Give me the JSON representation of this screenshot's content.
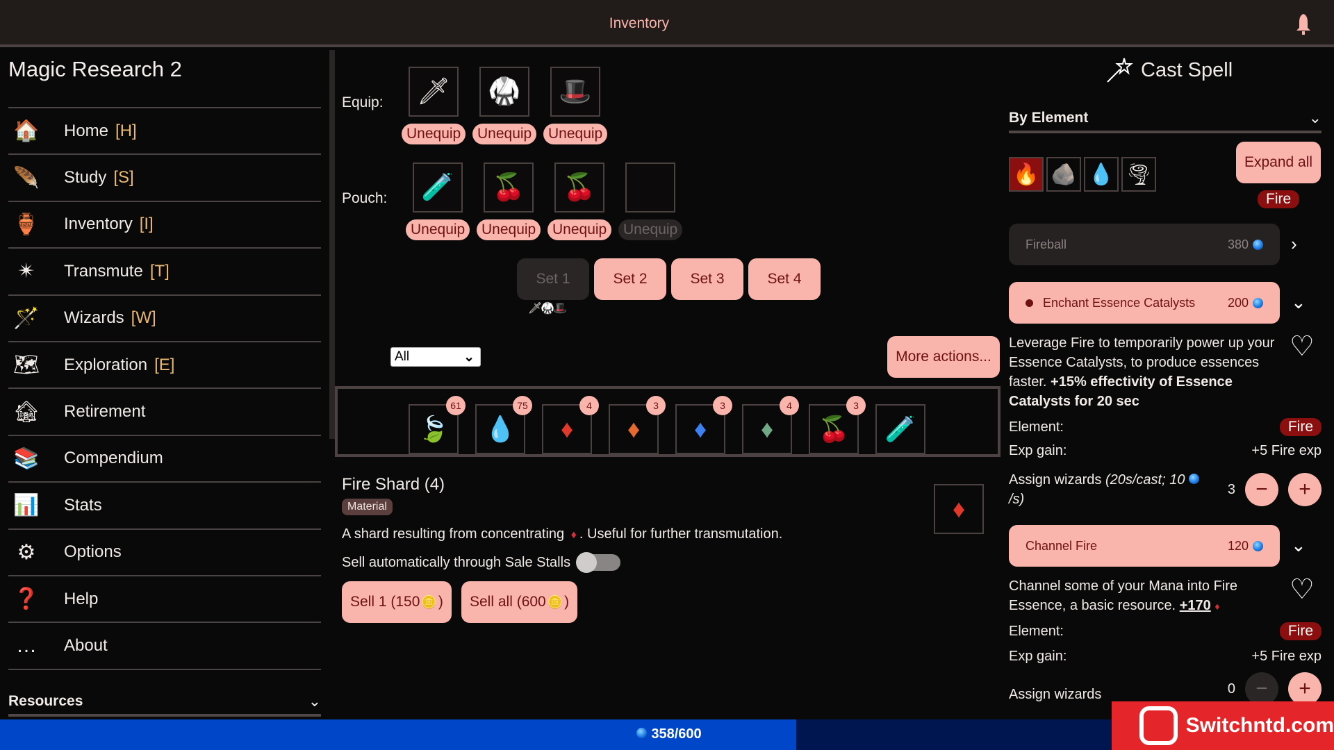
{
  "header": {
    "title": "Inventory",
    "notification_icon": "bell-icon"
  },
  "sidebar": {
    "app_title": "Magic Research 2",
    "items": [
      {
        "label": "Home",
        "key": "[H]",
        "icon": "🏠"
      },
      {
        "label": "Study",
        "key": "[S]",
        "icon": "🪶"
      },
      {
        "label": "Inventory",
        "key": "[I]",
        "icon": "🏺"
      },
      {
        "label": "Transmute",
        "key": "[T]",
        "icon": "✴"
      },
      {
        "label": "Wizards",
        "key": "[W]",
        "icon": "🪄"
      },
      {
        "label": "Exploration",
        "key": "[E]",
        "icon": "🗺"
      },
      {
        "label": "Retirement",
        "key": "",
        "icon": "🏚"
      },
      {
        "label": "Compendium",
        "key": "",
        "icon": "📚"
      },
      {
        "label": "Stats",
        "key": "",
        "icon": "📊"
      },
      {
        "label": "Options",
        "key": "",
        "icon": "⚙"
      },
      {
        "label": "Help",
        "key": "",
        "icon": "❓"
      },
      {
        "label": "About",
        "key": "",
        "icon": "…"
      }
    ],
    "resources_label": "Resources"
  },
  "main": {
    "equip_label": "Equip:",
    "pouch_label": "Pouch:",
    "equip_slots": [
      {
        "item": "sword",
        "icon": "🗡",
        "button": "Unequip"
      },
      {
        "item": "armor",
        "icon": "🥋",
        "button": "Unequip"
      },
      {
        "item": "hat",
        "icon": "🎩",
        "button": "Unequip"
      }
    ],
    "pouch_slots": [
      {
        "item": "potion",
        "icon": "🧪",
        "button": "Unequip",
        "disabled": false
      },
      {
        "item": "cherries",
        "icon": "🍒",
        "button": "Unequip",
        "disabled": false
      },
      {
        "item": "cherries",
        "icon": "🍒",
        "button": "Unequip",
        "disabled": false
      },
      {
        "item": "empty",
        "icon": "",
        "button": "Unequip",
        "disabled": true
      }
    ],
    "sets": [
      {
        "label": "Set 1",
        "active": true
      },
      {
        "label": "Set 2",
        "active": false
      },
      {
        "label": "Set 3",
        "active": false
      },
      {
        "label": "Set 4",
        "active": false
      }
    ],
    "set_preview": "🗡🥋🎩",
    "filter": {
      "selected": "All"
    },
    "more_actions_label": "More actions...",
    "items": [
      {
        "name": "teal-leaf",
        "icon": "🍃",
        "count": "61",
        "color": "#19c3b3"
      },
      {
        "name": "water-essence",
        "icon": "💧",
        "count": "75",
        "color": "#3ba5ff"
      },
      {
        "name": "fire-shard",
        "icon": "♦",
        "count": "4",
        "color": "#e0392b"
      },
      {
        "name": "earth-shard",
        "icon": "♦",
        "count": "3",
        "color": "#e56a2f"
      },
      {
        "name": "water-shard",
        "icon": "♦",
        "count": "3",
        "color": "#3b7ff0"
      },
      {
        "name": "air-shard",
        "icon": "♦",
        "count": "4",
        "color": "#6fa985"
      },
      {
        "name": "cherries",
        "icon": "🍒",
        "count": "3",
        "color": "#e02a3a"
      },
      {
        "name": "potion",
        "icon": "🧪",
        "count": "",
        "color": "#c9262d"
      }
    ],
    "detail": {
      "title": "Fire Shard (4)",
      "tag": "Material",
      "desc_before": "A shard resulting from concentrating",
      "desc_after": ". Useful for further transmutation.",
      "autosell_label": "Sell automatically through Sale Stalls",
      "autosell_on": false,
      "sell_one_label": "Sell 1 (150",
      "sell_all_label": "Sell all (600",
      "coin_icon": "🪙",
      "close_paren": ")"
    }
  },
  "cast": {
    "title": "Cast Spell",
    "group_label": "By Element",
    "elements": [
      {
        "name": "fire",
        "icon": "🔥",
        "active": true
      },
      {
        "name": "earth",
        "icon": "🪨",
        "active": false
      },
      {
        "name": "water",
        "icon": "💧",
        "active": false
      },
      {
        "name": "air",
        "icon": "🌪",
        "active": false
      }
    ],
    "expand_all_label": "Expand all",
    "current_element": "Fire",
    "spells": [
      {
        "name": "Fireball",
        "cost": "380",
        "disabled": true
      },
      {
        "name": "Enchant Essence Catalysts",
        "cost": "200",
        "active": true,
        "desc": "Leverage Fire to temporarily power up your Essence Catalysts, to produce essences faster. ",
        "desc_bold": "+15% effectivity of Essence Catalysts for 20 sec",
        "element_label": "Element:",
        "element": "Fire",
        "exp_label": "Exp gain:",
        "exp": "+5 Fire exp",
        "assign_label": "Assign wizards",
        "assign_note": "(20s/cast; 10",
        "assign_note_end": "/s)",
        "wizards": "3"
      },
      {
        "name": "Channel Fire",
        "cost": "120",
        "desc": "Channel some of your Mana into Fire Essence, a basic resource. ",
        "desc_bold": "+170",
        "element_label": "Element:",
        "element": "Fire",
        "exp_label": "Exp gain:",
        "exp": "+5 Fire exp",
        "assign_label": "Assign wizards",
        "wizards": "0"
      }
    ]
  },
  "mana": {
    "current": 358,
    "max": 600,
    "text": "358/600",
    "color": "#0046c8"
  },
  "watermark": {
    "text": "Switchntd.com"
  }
}
